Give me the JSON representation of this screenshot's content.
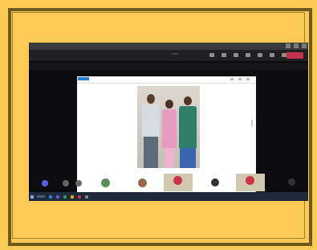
{
  "window": {
    "title": "",
    "controls": [
      "minimize-icon",
      "maximize-icon",
      "close-icon"
    ]
  },
  "toolbar": {
    "timer": "",
    "share_status": "",
    "tools": [
      "people-icon",
      "chat-icon",
      "reactions-icon",
      "more-icon",
      "camera-icon",
      "mic-icon",
      "share-icon"
    ],
    "leave_label": "",
    "leave_color": "#c4314b"
  },
  "banner": {
    "text": "",
    "close": ""
  },
  "self_view": {
    "label": ""
  },
  "participants": [
    {
      "name": "",
      "avatar_color": "#5a5ee0"
    },
    {
      "name": "",
      "avatar_color": "#666666"
    },
    {
      "name": "",
      "avatar_color": "#666666"
    },
    {
      "name": "",
      "avatar_color": "#5e8c5a"
    },
    {
      "name": "",
      "avatar_color": "#9a6a4e"
    },
    {
      "name": "",
      "avatar_color": "#cc3344"
    },
    {
      "name": "",
      "avatar_color": "#333333"
    },
    {
      "name": "",
      "avatar_color": "#cc3344"
    },
    {
      "name": "",
      "avatar_color": "#333333"
    }
  ],
  "taskbar": {
    "tray_text": ""
  },
  "colors": {
    "background": "#fbc956",
    "frame": "#6f5a1e",
    "screen": "#0c0c0f",
    "accent": "#2b7cd3"
  }
}
